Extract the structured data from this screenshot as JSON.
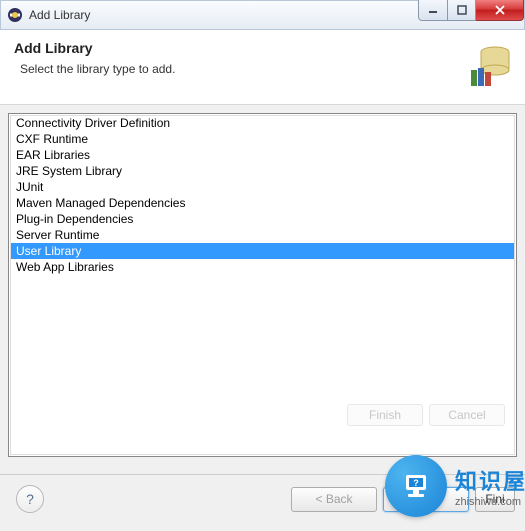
{
  "window": {
    "title": "Add Library"
  },
  "header": {
    "heading": "Add Library",
    "subheading": "Select the library type to add."
  },
  "library_types": [
    "Connectivity Driver Definition",
    "CXF Runtime",
    "EAR Libraries",
    "JRE System Library",
    "JUnit",
    "Maven Managed Dependencies",
    "Plug-in Dependencies",
    "Server Runtime",
    "User Library",
    "Web App Libraries"
  ],
  "selected_index": 8,
  "buttons": {
    "back": "< Back",
    "next": "Next >",
    "finish": "Finish",
    "cancel": "Cancel",
    "help": "?"
  },
  "watermark": {
    "cn": "知识屋",
    "url": "zhishiwu.com"
  }
}
